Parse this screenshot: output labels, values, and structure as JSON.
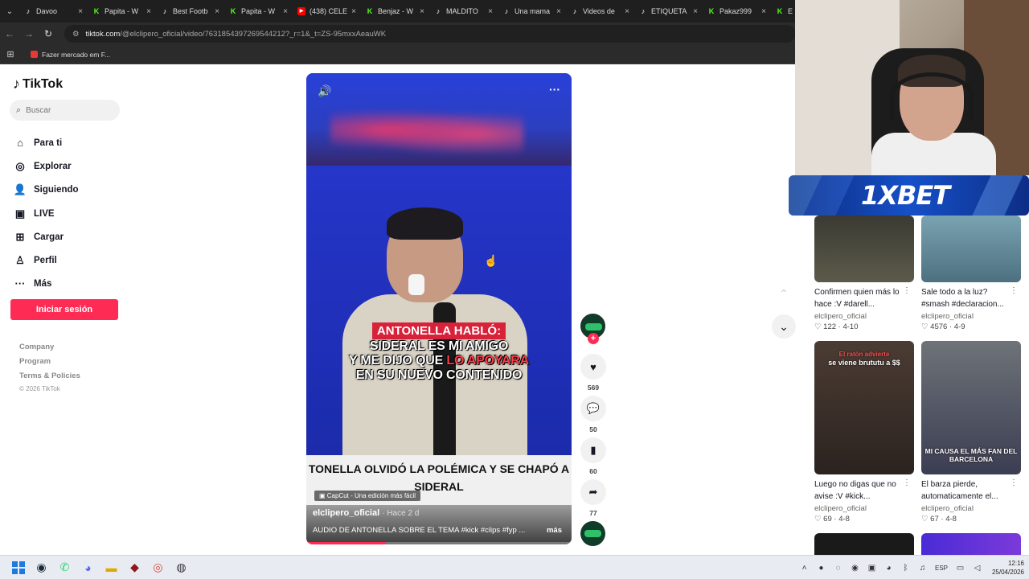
{
  "browser": {
    "tabs": [
      {
        "icon": "tiktok-icon",
        "title": "Davoo"
      },
      {
        "icon": "kick-icon",
        "title": "Papita - W"
      },
      {
        "icon": "tiktok-icon",
        "title": "Best Footb"
      },
      {
        "icon": "kick-icon",
        "title": "Papita - W"
      },
      {
        "icon": "youtube-icon",
        "title": "(438) CELE"
      },
      {
        "icon": "kick-icon",
        "title": "Benjaz - W"
      },
      {
        "icon": "tiktok-icon",
        "title": "MALDITO"
      },
      {
        "icon": "tiktok-icon",
        "title": "Una mama"
      },
      {
        "icon": "tiktok-icon",
        "title": "Videos de"
      },
      {
        "icon": "tiktok-icon",
        "title": "ETIQUETA"
      },
      {
        "icon": "kick-icon",
        "title": "Pakaz999"
      },
      {
        "icon": "kick-icon",
        "title": "E"
      }
    ],
    "url_host": "tiktok.com",
    "url_path": "/@elclipero_oficial/video/7631854397269544212?_r=1&_t=ZS-95mxxAeauWK",
    "bookmark": "Fazer mercado em F..."
  },
  "sidebar": {
    "logo": "TikTok",
    "search_placeholder": "Buscar",
    "menu": [
      {
        "icon": "home-icon",
        "glyph": "⌂",
        "label": "Para ti"
      },
      {
        "icon": "compass-icon",
        "glyph": "◎",
        "label": "Explorar"
      },
      {
        "icon": "following-icon",
        "glyph": "👤",
        "label": "Siguiendo"
      },
      {
        "icon": "live-icon",
        "glyph": "▣",
        "label": "LIVE"
      },
      {
        "icon": "upload-icon",
        "glyph": "⊞",
        "label": "Cargar"
      },
      {
        "icon": "profile-icon",
        "glyph": "♙",
        "label": "Perfil"
      },
      {
        "icon": "more-icon",
        "glyph": "···",
        "label": "Más"
      }
    ],
    "login": "Iniciar sesión",
    "footer": [
      "Company",
      "Program",
      "Terms & Policies"
    ],
    "copyright": "© 2026 TikTok"
  },
  "video": {
    "caption_header": "ANTONELLA HABLÓ:",
    "caption_line1": "SIDERAL ES MI AMIGO",
    "caption_line2_a": "Y ME DIJO QUE ",
    "caption_line2_b": "LO APOYARA",
    "caption_line3": "EN SU NUEVO CONTENIDO",
    "bottom_title_1": "TONELLA OLVIDÓ LA POLÉMICA Y SE CHAPÓ A",
    "bottom_title_2": "SIDERAL",
    "capcut": "CapCut - Una edición más fácil",
    "author": "elclipero_oficial",
    "ago": "· Hace 2 d",
    "description": "AUDIO DE ANTONELLA SOBRE EL TEMA  #kick #clips #fyp ...",
    "more": "más",
    "progress": 0.3
  },
  "actions": {
    "likes": "569",
    "comments": "50",
    "saves": "60",
    "shares": "77"
  },
  "overlay": {
    "sponsor": "1XBET"
  },
  "recommendations": [
    {
      "title": "Confirmen quien más lo hace :V #darell...",
      "author": "elclipero_oficial",
      "likes": "122",
      "date": "4-10"
    },
    {
      "title": "Sale todo a la luz? #smash #declaracion...",
      "author": "elclipero_oficial",
      "likes": "4576",
      "date": "4-9"
    },
    {
      "title": "Luego no digas que no avise :V #kick...",
      "author": "elclipero_oficial",
      "likes": "69",
      "date": "4-8",
      "thumb_text_red": "El ratón advierte",
      "thumb_text": "se viene brututu a $$"
    },
    {
      "title": "El barza pierde, automaticamente el...",
      "author": "elclipero_oficial",
      "likes": "67",
      "date": "4-8",
      "thumb_text": "MI CAUSA EL MÁS FAN DEL BARCELONA"
    }
  ],
  "taskbar": {
    "lang": "ESP",
    "time": "12:16",
    "date": "25/04/2026"
  }
}
